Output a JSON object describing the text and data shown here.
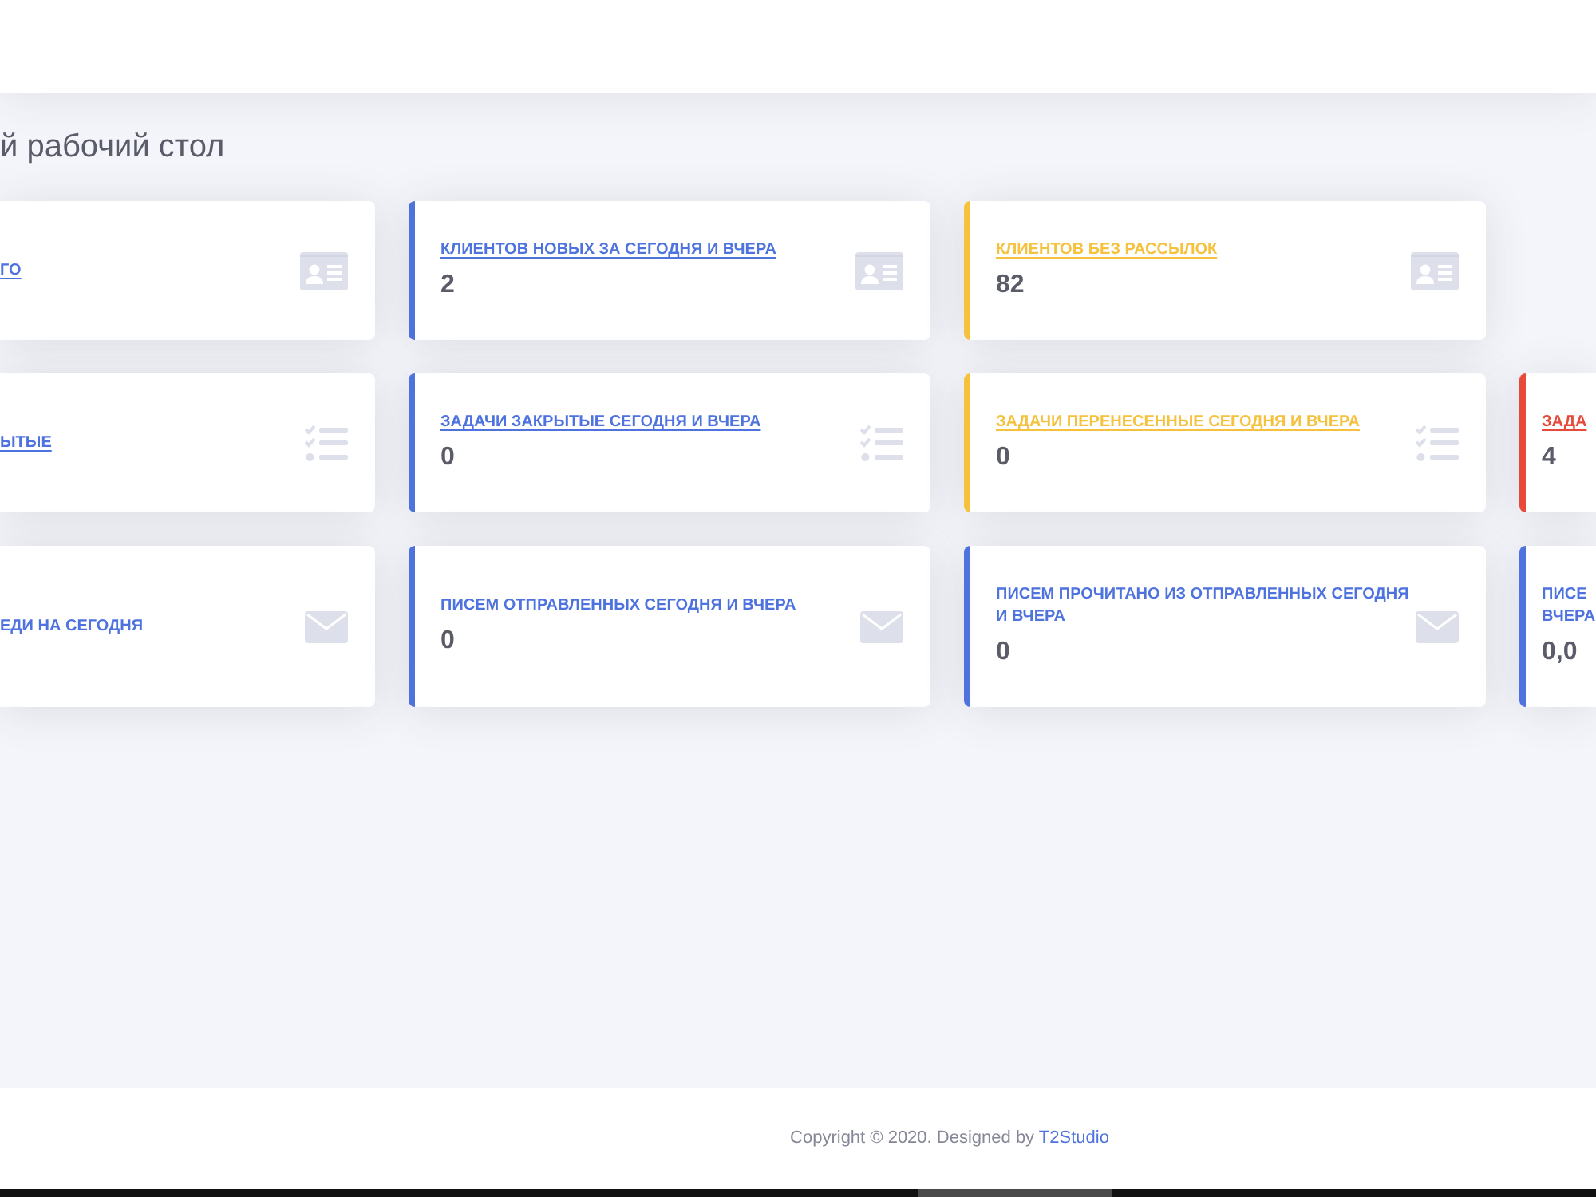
{
  "page_title": "й рабочий стол",
  "card_rows": [
    {
      "kind": "clients",
      "cards": [
        {
          "label": "ГО",
          "color": "#4e73df",
          "linked": true
        },
        {
          "label": "КЛИЕНТОВ НОВЫХ ЗА СЕГОДНЯ И ВЧЕРА",
          "value": "2",
          "color": "#4e73df",
          "linked": true
        },
        {
          "label": "КЛИЕНТОВ БЕЗ РАССЫЛОК",
          "value": "82",
          "color": "#f6c23e",
          "linked": true
        }
      ]
    },
    {
      "kind": "tasks",
      "cards": [
        {
          "label": "ЫТЫЕ",
          "color": "#4e73df",
          "linked": true
        },
        {
          "label": "ЗАДАЧИ ЗАКРЫТЫЕ СЕГОДНЯ И ВЧЕРА",
          "value": "0",
          "color": "#4e73df",
          "linked": true
        },
        {
          "label": "ЗАДАЧИ ПЕРЕНЕСЕННЫЕ СЕГОДНЯ И ВЧЕРА",
          "value": "0",
          "color": "#f6c23e",
          "linked": true
        },
        {
          "label": "ЗАДА",
          "value": "4",
          "color": "#e74a3b",
          "linked": true
        }
      ]
    },
    {
      "kind": "letters",
      "cards": [
        {
          "label": "ЕДИ НА СЕГОДНЯ",
          "color": "#4e73df",
          "linked": false
        },
        {
          "label": "ПИСЕМ ОТПРАВЛЕННЫХ СЕГОДНЯ И ВЧЕРА",
          "value": "0",
          "color": "#4e73df",
          "linked": false
        },
        {
          "label": "ПИСЕМ ПРОЧИТАНО ИЗ ОТПРАВЛЕННЫХ СЕГОДНЯ И ВЧЕРА",
          "value": "0",
          "color": "#4e73df",
          "linked": false
        },
        {
          "label": "ПИСЕ ВЧЕРА",
          "value": "0,0",
          "color": "#4e73df",
          "linked": false
        }
      ]
    }
  ],
  "footer": {
    "text": "Copyright © 2020. Designed by",
    "link": "T2Studio"
  }
}
